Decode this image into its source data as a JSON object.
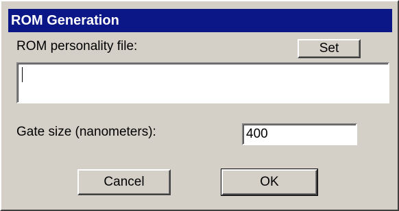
{
  "window": {
    "title": "ROM Generation"
  },
  "rom_personality": {
    "label": "ROM personality file:",
    "set_button": "Set",
    "value": ""
  },
  "gate_size": {
    "label": "Gate size (nanometers):",
    "value": "400"
  },
  "buttons": {
    "cancel": "Cancel",
    "ok": "OK"
  }
}
